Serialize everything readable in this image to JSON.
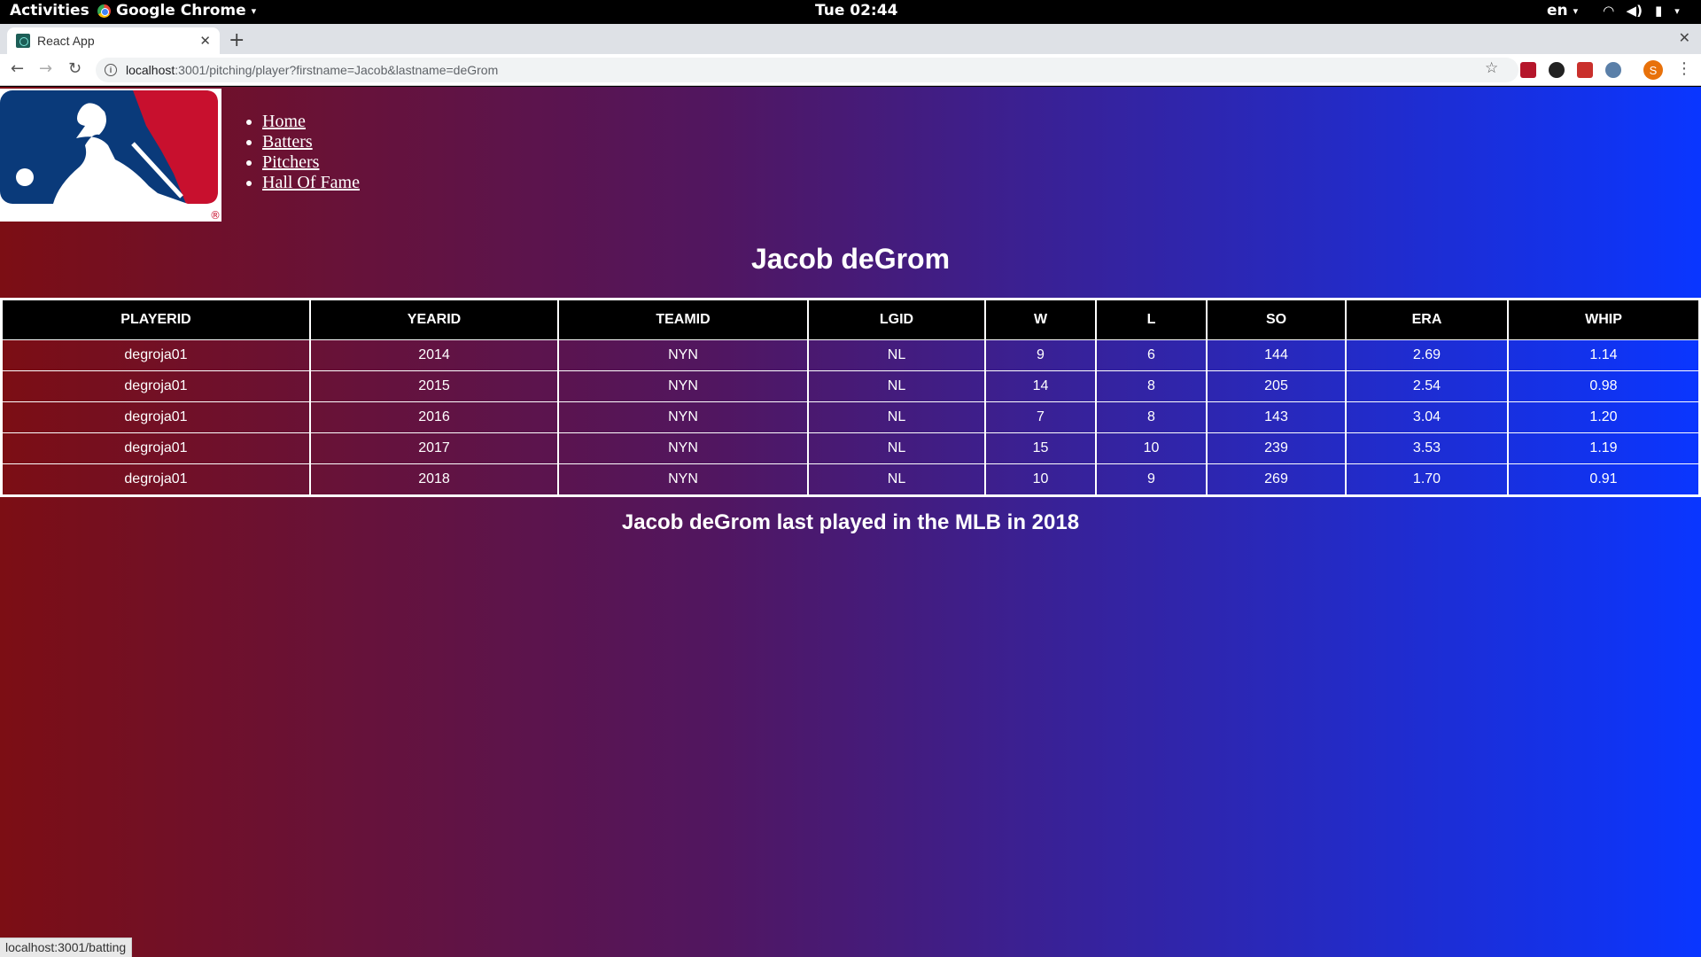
{
  "system": {
    "activities": "Activities",
    "app_name": "Google Chrome",
    "clock": "Tue 02:44",
    "language": "en"
  },
  "browser": {
    "tab_title": "React App",
    "url_host": "localhost",
    "url_path": ":3001/pitching/player?firstname=Jacob&lastname=deGrom",
    "status_url": "localhost:3001/batting",
    "profile_initial": "S"
  },
  "nav": {
    "items": [
      "Home",
      "Batters",
      "Pitchers",
      "Hall Of Fame"
    ]
  },
  "page": {
    "title": "Jacob deGrom",
    "footer": "Jacob deGrom last played in the MLB in 2018"
  },
  "table": {
    "headers": [
      "PLAYERID",
      "YEARID",
      "TEAMID",
      "LGID",
      "W",
      "L",
      "SO",
      "ERA",
      "WHIP"
    ],
    "rows": [
      [
        "degroja01",
        "2014",
        "NYN",
        "NL",
        "9",
        "6",
        "144",
        "2.69",
        "1.14"
      ],
      [
        "degroja01",
        "2015",
        "NYN",
        "NL",
        "14",
        "8",
        "205",
        "2.54",
        "0.98"
      ],
      [
        "degroja01",
        "2016",
        "NYN",
        "NL",
        "7",
        "8",
        "143",
        "3.04",
        "1.20"
      ],
      [
        "degroja01",
        "2017",
        "NYN",
        "NL",
        "15",
        "10",
        "239",
        "3.53",
        "1.19"
      ],
      [
        "degroja01",
        "2018",
        "NYN",
        "NL",
        "10",
        "9",
        "269",
        "1.70",
        "0.91"
      ]
    ]
  },
  "colors": {
    "gradient_left": "#7c0e14",
    "gradient_mid": "#511660",
    "gradient_right": "#0a36ff",
    "logo_blue": "#0a3a7a",
    "logo_red": "#c8102e"
  }
}
